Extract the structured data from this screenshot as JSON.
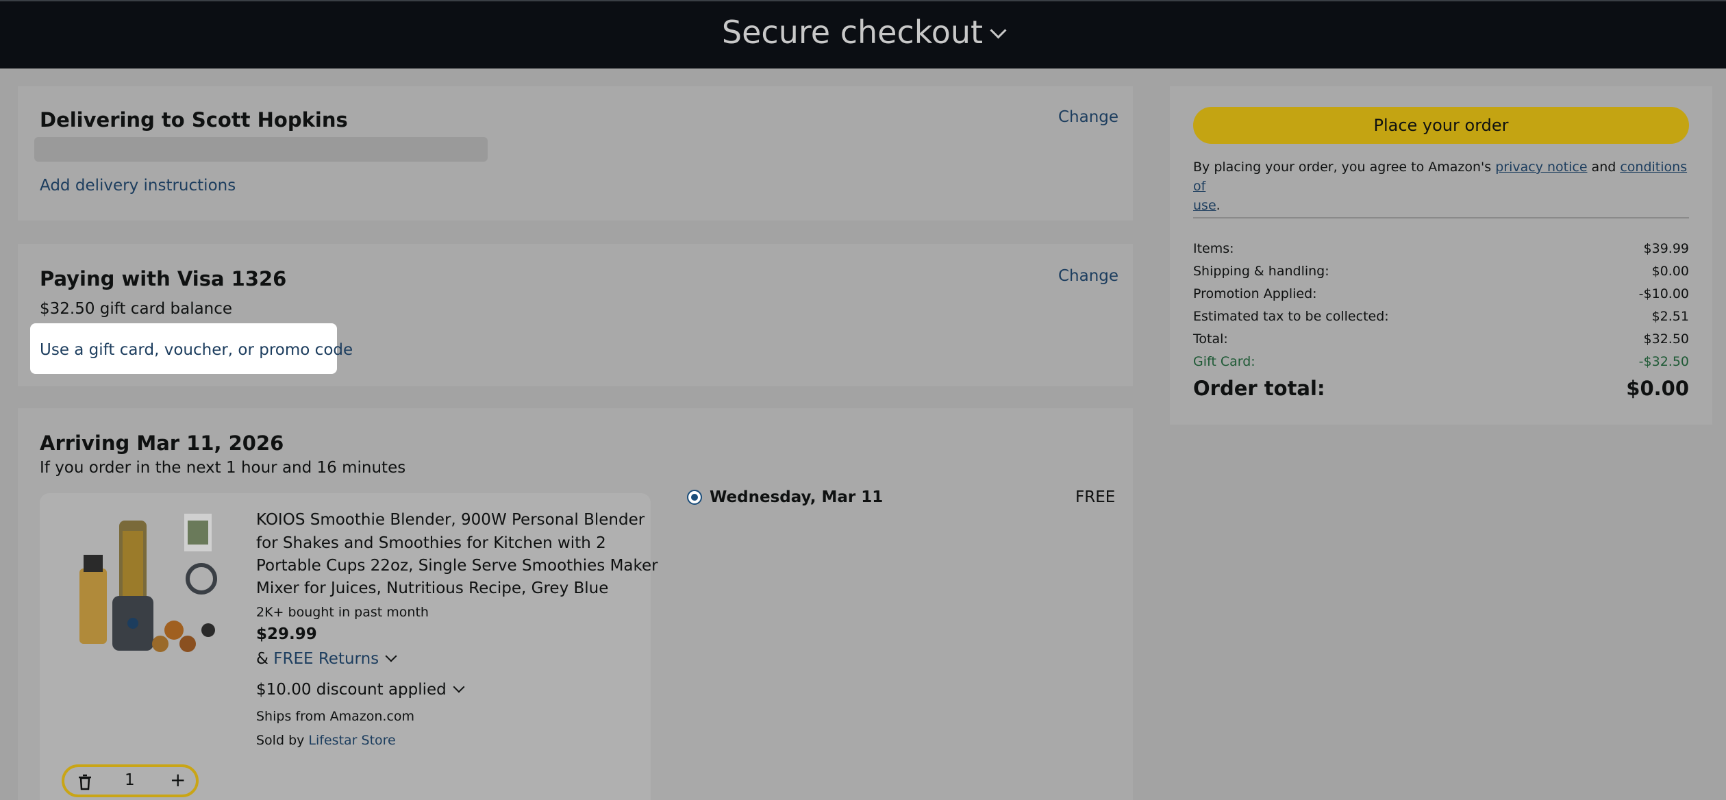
{
  "header": {
    "title": "Secure checkout"
  },
  "delivery": {
    "heading": "Delivering to Scott Hopkins",
    "change_label": "Change",
    "instructions_link": "Add delivery instructions"
  },
  "payment": {
    "heading": "Paying with Visa 1326",
    "change_label": "Change",
    "gift_balance": "$32.50 gift card balance",
    "promo_link": "Use a gift card, voucher, or promo code"
  },
  "shipment": {
    "arriving": "Arriving Mar 11, 2026",
    "countdown": "If you order in the next 1 hour and 16 minutes",
    "delivery_option": {
      "label": "Wednesday, Mar 11",
      "price": "FREE",
      "selected": true
    },
    "item": {
      "title_lines": [
        "KOIOS Smoothie Blender, 900W Personal Blender",
        "for Shakes and Smoothies for Kitchen with 2",
        "Portable Cups 22oz, Single Serve Smoothies Maker",
        "Mixer for Juices, Nutritious Recipe, Grey Blue"
      ],
      "bought": "2K+ bought in past month",
      "price": "$29.99",
      "returns_prefix": "& ",
      "returns_link": "FREE Returns",
      "discount": "$10.00 discount applied",
      "ships_from": "Ships from Amazon.com",
      "sold_by_prefix": "Sold by ",
      "sold_by": "Lifestar Store",
      "quantity": "1"
    }
  },
  "summary": {
    "place_order": "Place your order",
    "agree_prefix": "By placing your order, you agree to Amazon's ",
    "privacy_link": "privacy notice",
    "and": " and ",
    "conditions_link_1": "conditions of",
    "conditions_link_2": "use",
    "period": ".",
    "rows": [
      {
        "label": "Items:",
        "value": "$39.99"
      },
      {
        "label": "Shipping & handling:",
        "value": "$0.00"
      },
      {
        "label": "Promotion Applied:",
        "value": "-$10.00"
      },
      {
        "label": "Estimated tax to be collected:",
        "value": "$2.51"
      },
      {
        "label": "Total:",
        "value": "$32.50"
      },
      {
        "label": "Gift Card:",
        "value": "-$32.50"
      }
    ],
    "order_total_label": "Order total:",
    "order_total_value": "$0.00"
  },
  "colors": {
    "place_button": "#c4a412",
    "header_bg": "#0b0e13",
    "link": "#1c3d5e",
    "gift_card_green": "#1f5a36"
  }
}
